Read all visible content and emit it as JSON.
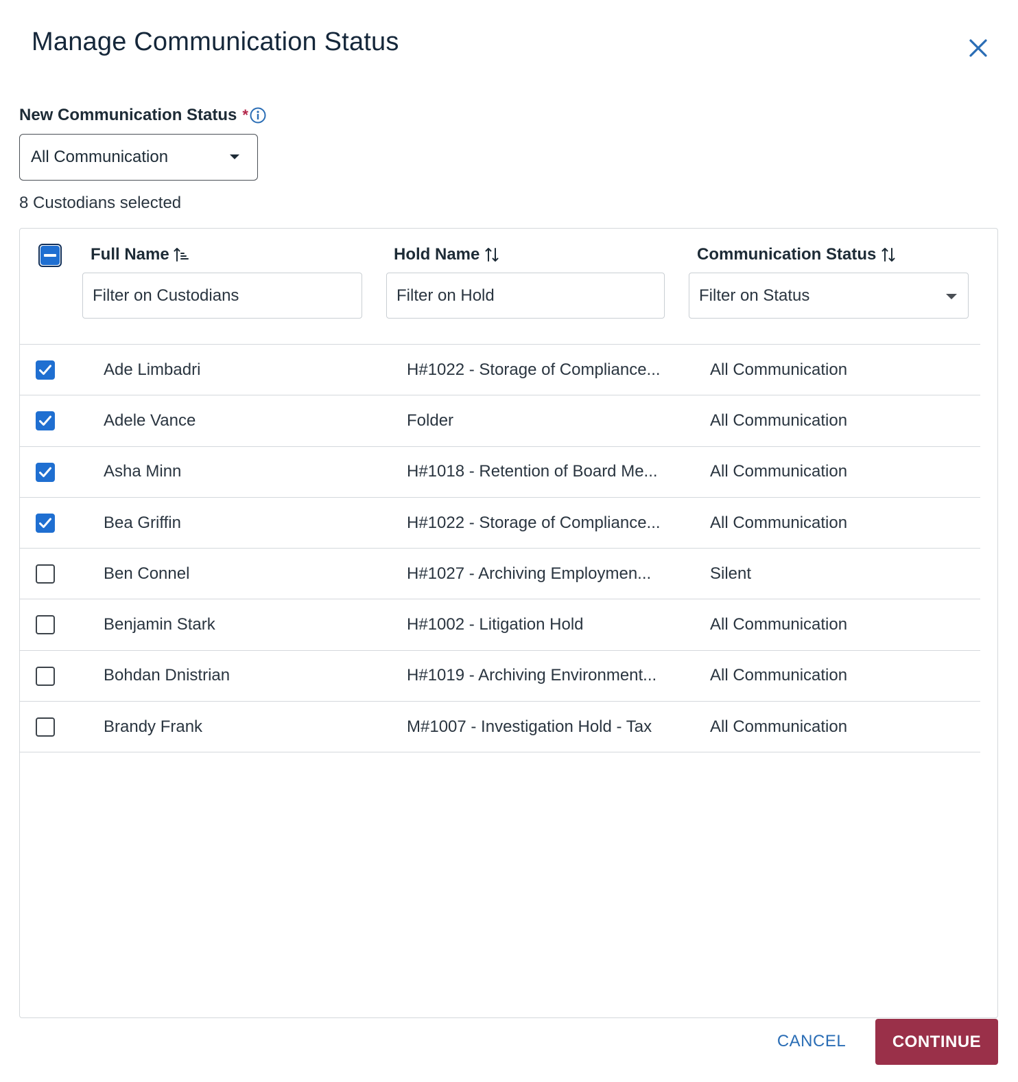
{
  "dialog": {
    "title": "Manage Communication Status",
    "close_icon": "close-icon"
  },
  "new_status": {
    "label": "New Communication Status",
    "required_mark": "*",
    "info_icon": "info-icon",
    "selected_value": "All Communication"
  },
  "selection": {
    "count_text": "8 Custodians selected"
  },
  "table": {
    "header_checkbox_state": "indeterminate",
    "columns": [
      {
        "label": "Full Name",
        "sort_icon": "sort-ascending-icon",
        "filter_placeholder": "Filter on Custodians"
      },
      {
        "label": "Hold Name",
        "sort_icon": "sort-icon",
        "filter_placeholder": "Filter on Hold"
      },
      {
        "label": "Communication Status",
        "sort_icon": "sort-icon",
        "filter_placeholder": "Filter on Status"
      }
    ],
    "rows": [
      {
        "checked": true,
        "name": "Ade Limbadri",
        "hold": "H#1022 - Storage of Compliance...",
        "status": "All Communication"
      },
      {
        "checked": true,
        "name": "Adele Vance",
        "hold": "Folder",
        "status": "All Communication"
      },
      {
        "checked": true,
        "name": "Asha Minn",
        "hold": "H#1018 - Retention of Board Me...",
        "status": "All Communication"
      },
      {
        "checked": true,
        "name": "Bea Griffin",
        "hold": "H#1022 - Storage of Compliance...",
        "status": "All Communication"
      },
      {
        "checked": false,
        "name": "Ben Connel",
        "hold": "H#1027 - Archiving Employmen...",
        "status": "Silent"
      },
      {
        "checked": false,
        "name": "Benjamin Stark",
        "hold": "H#1002 - Litigation Hold",
        "status": "All Communication"
      },
      {
        "checked": false,
        "name": "Bohdan Dnistrian",
        "hold": "H#1019 - Archiving Environment...",
        "status": "All Communication"
      },
      {
        "checked": false,
        "name": "Brandy Frank",
        "hold": "M#1007 - Investigation Hold - Tax",
        "status": "All Communication"
      }
    ]
  },
  "footer": {
    "cancel_label": "CANCEL",
    "continue_label": "CONTINUE"
  },
  "colors": {
    "accent_blue": "#1f6fd1",
    "link_blue": "#2a6db5",
    "continue_bg": "#9a3049",
    "required_red": "#b3264a"
  }
}
